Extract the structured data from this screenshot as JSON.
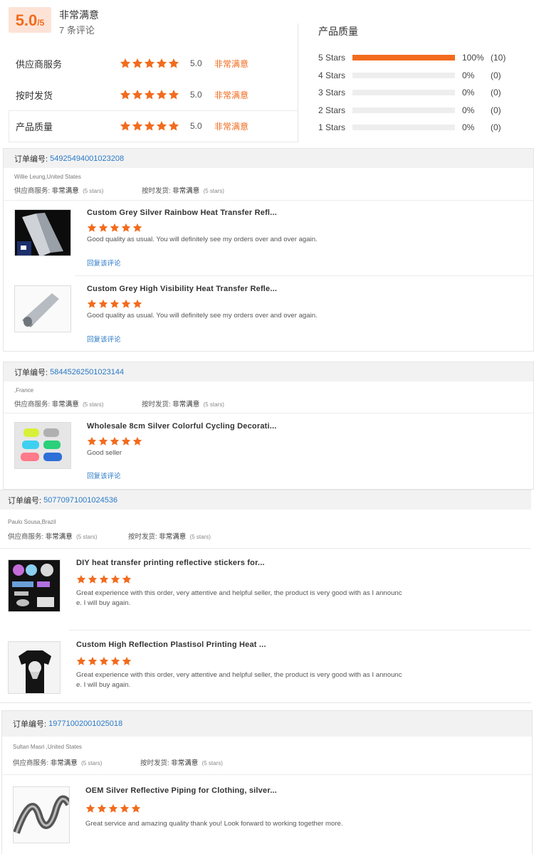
{
  "summary": {
    "score": "5.0",
    "score_max": "/5",
    "level": "非常满意",
    "count": "7 条评论"
  },
  "ratings": [
    {
      "label": "供应商服务",
      "value": "5.0",
      "text": "非常满意"
    },
    {
      "label": "按时发货",
      "value": "5.0",
      "text": "非常满意"
    },
    {
      "label": "产品质量",
      "value": "5.0",
      "text": "非常满意"
    }
  ],
  "quality": {
    "title": "产品质量",
    "rows": [
      {
        "label": "5 Stars",
        "pct": "100%",
        "count": "(10)",
        "fraction": 1.0
      },
      {
        "label": "4 Stars",
        "pct": "0%",
        "count": "(0)",
        "fraction": 0
      },
      {
        "label": "3 Stars",
        "pct": "0%",
        "count": "(0)",
        "fraction": 0
      },
      {
        "label": "2 Stars",
        "pct": "0%",
        "count": "(0)",
        "fraction": 0
      },
      {
        "label": "1 Stars",
        "pct": "0%",
        "count": "(0)",
        "fraction": 0
      }
    ]
  },
  "labels": {
    "order_no": "订单编号:",
    "supplier_service": "供应商服务:",
    "on_time": "按时发货:",
    "very_satisfied": "非常满意",
    "five_stars": "(5 stars)",
    "reply": "回复该评论"
  },
  "orders": [
    {
      "number": "54925494001023208",
      "buyer": "Willie Leung,United States",
      "items": [
        {
          "title": "Custom Grey Silver Rainbow Heat Transfer Refl...",
          "comment": "Good quality as usual.  You will definitely see my orders over and over again."
        },
        {
          "title": "Custom Grey High Visibility Heat Transfer Refle...",
          "comment": "Good quality as usual.  You will definitely see my orders over and over again."
        }
      ]
    },
    {
      "number": "58445262501023144",
      "buyer": ",France",
      "items": [
        {
          "title": "Wholesale 8cm Silver Colorful Cycling Decorati...",
          "comment": "Good seller"
        }
      ]
    },
    {
      "number": "50770971001024536",
      "buyer": "Paulo Sousa,Brazil",
      "items": [
        {
          "title": "DIY heat transfer printing reflective stickers for...",
          "comment": "Great experience with this order, very attentive and helpful seller, the product is very good with as I announc",
          "comment2": "e. I will buy again."
        },
        {
          "title": "Custom High Reflection Plastisol Printing Heat ...",
          "comment": "Great experience with this order, very attentive and helpful seller, the product is very good with as I announc",
          "comment2": "e. I will buy again."
        }
      ]
    },
    {
      "number": "19771002001025018",
      "buyer": "Sultan Masri ,United States",
      "items": [
        {
          "title": "OEM Silver Reflective Piping for Clothing, silver...",
          "comment": "Great service and amazing quality thank you! Look forward to working together more."
        }
      ]
    }
  ],
  "colors": {
    "accent": "#f26b1d",
    "link": "#2a7ac7"
  }
}
